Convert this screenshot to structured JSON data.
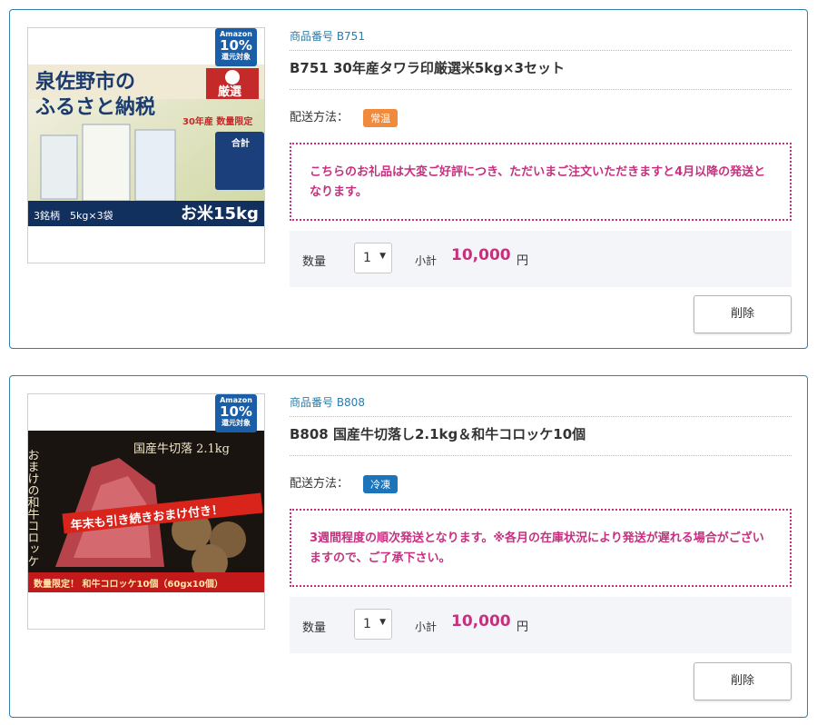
{
  "items": [
    {
      "product_number": "商品番号 B751",
      "name": "B751 30年産タワラ印厳選米5kg×3セット",
      "shipping_label": "配送方法：",
      "shipping_tag": "常温",
      "notice": "こちらのお礼品は大変ご好評につき、ただいまご注文いただきますと4月以降の発送となります。",
      "qty_label": "数量",
      "qty_value": "1",
      "subtotal_label": "小計",
      "price": "10,000",
      "yen": "円",
      "delete_label": "削除",
      "badge": {
        "line1": "Amazon",
        "line2": "10%",
        "line3": "還元対象"
      },
      "image_text": {
        "headline1": "泉佐野市の",
        "headline2": "ふるさと納税",
        "seal": "厳選",
        "limited": "30年産 数量限定",
        "total": "合計",
        "okome": "お米15kg",
        "brands": "3銘柄　5kg×3袋"
      }
    },
    {
      "product_number": "商品番号 B808",
      "name": "B808 国産牛切落し2.1kg＆和牛コロッケ10個",
      "shipping_label": "配送方法：",
      "shipping_tag": "冷凍",
      "notice": "3週間程度の順次発送となります。※各月の在庫状況により発送が遅れる場合がございますので、ご了承下さい。",
      "qty_label": "数量",
      "qty_value": "1",
      "subtotal_label": "小計",
      "price": "10,000",
      "yen": "円",
      "delete_label": "削除",
      "badge": {
        "line1": "Amazon",
        "line2": "10%",
        "line3": "還元対象"
      },
      "image_text": {
        "headline": "国産牛切落 2.1kg",
        "vertical": "おまけの和牛コロッケ",
        "banner": "年末も引き続きおまけ付き！",
        "footer": "数量限定！ 和牛コロッケ10個（60gx10個）"
      }
    }
  ],
  "colors": {
    "accent": "#2f7fa6",
    "price": "#c7307f",
    "room_temp": "#f08a3c",
    "frozen": "#1c75bb"
  }
}
